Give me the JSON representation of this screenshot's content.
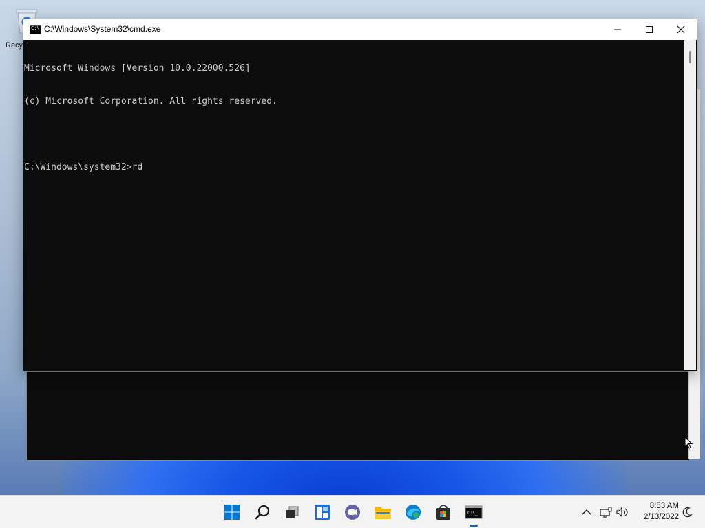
{
  "desktop": {
    "recycle_bin_label": "Recy"
  },
  "cmd_window": {
    "title": "C:\\Windows\\System32\\cmd.exe",
    "icon_text": "C:\\",
    "lines": [
      "Microsoft Windows [Version 10.0.22000.526]",
      "(c) Microsoft Corporation. All rights reserved.",
      "",
      "C:\\Windows\\system32>rd"
    ],
    "controls": {
      "minimize": "minimize",
      "maximize": "maximize",
      "close": "close"
    }
  },
  "taskbar": {
    "apps": [
      {
        "name": "start",
        "icon": "windows-logo-icon"
      },
      {
        "name": "search",
        "icon": "search-icon"
      },
      {
        "name": "task-view",
        "icon": "task-view-icon"
      },
      {
        "name": "widgets",
        "icon": "widgets-icon"
      },
      {
        "name": "chat",
        "icon": "teams-chat-icon"
      },
      {
        "name": "file-explorer",
        "icon": "folder-icon"
      },
      {
        "name": "edge",
        "icon": "edge-icon"
      },
      {
        "name": "store",
        "icon": "store-icon"
      },
      {
        "name": "command-prompt",
        "icon": "cmd-icon",
        "active": true
      }
    ],
    "tray": {
      "time": "8:53 AM",
      "date": "2/13/2022"
    }
  },
  "colors": {
    "console_bg": "#0c0c0c",
    "console_fg": "#cccccc",
    "accent": "#0067c0"
  }
}
